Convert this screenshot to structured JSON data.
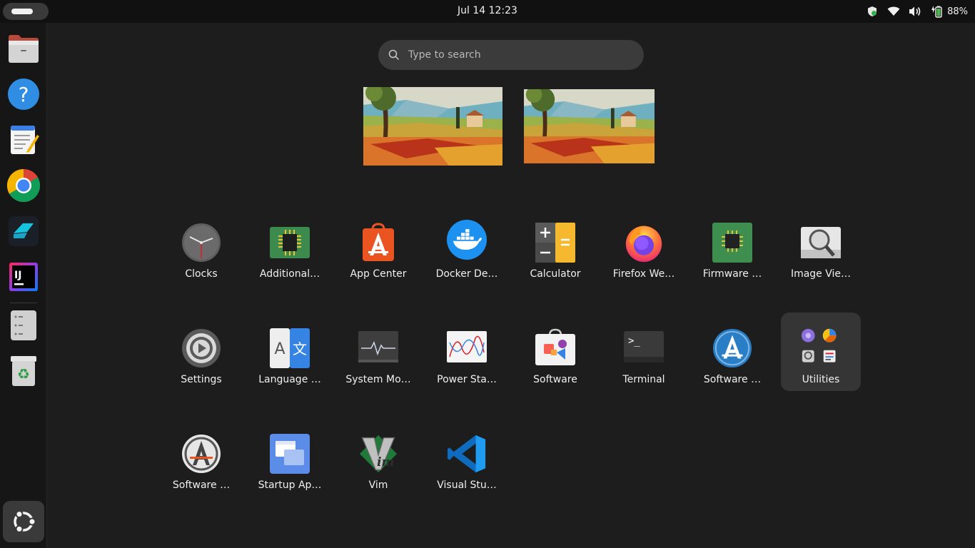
{
  "topbar": {
    "clock": "Jul 14  12:23",
    "battery_percent": "88%",
    "tray_icons": [
      "shield-icon",
      "wifi-icon",
      "volume-icon",
      "battery-icon"
    ]
  },
  "dock": {
    "items": [
      {
        "name": "files",
        "icon": "file-cabinet-icon"
      },
      {
        "name": "help",
        "icon": "help-icon"
      },
      {
        "name": "text-editor",
        "icon": "text-editor-icon"
      },
      {
        "name": "chrome",
        "icon": "chrome-icon"
      },
      {
        "name": "app-shape",
        "icon": "cyan-shape-icon"
      },
      {
        "name": "intellij",
        "icon": "intellij-icon",
        "text": "IJ"
      },
      {
        "name": "dash-app",
        "icon": "list-app-icon"
      },
      {
        "name": "trash",
        "icon": "trash-icon"
      }
    ],
    "show_apps": "ubuntu-logo-icon"
  },
  "search": {
    "placeholder": "Type to search",
    "value": ""
  },
  "apps": [
    {
      "label": "Clocks",
      "icon": "clock-icon"
    },
    {
      "label": "Additional…",
      "icon": "chip-icon"
    },
    {
      "label": "App Center",
      "icon": "app-center-icon"
    },
    {
      "label": "Docker De…",
      "icon": "docker-icon"
    },
    {
      "label": "Calculator",
      "icon": "calculator-icon"
    },
    {
      "label": "Firefox We…",
      "icon": "firefox-icon"
    },
    {
      "label": "Firmware …",
      "icon": "firmware-icon"
    },
    {
      "label": "Image Vie…",
      "icon": "image-viewer-icon"
    },
    {
      "label": "Settings",
      "icon": "gear-icon"
    },
    {
      "label": "Language …",
      "icon": "language-icon",
      "glyph_a": "A",
      "glyph_b": "文"
    },
    {
      "label": "System Mo…",
      "icon": "system-monitor-icon"
    },
    {
      "label": "Power Sta…",
      "icon": "power-stats-icon"
    },
    {
      "label": "Software",
      "icon": "software-bag-icon"
    },
    {
      "label": "Terminal",
      "icon": "terminal-icon",
      "glyph": ">_"
    },
    {
      "label": "Software …",
      "icon": "software-updater-icon"
    },
    {
      "label": "Utilities",
      "icon": "utilities-folder-icon"
    },
    {
      "label": "Software …",
      "icon": "software-properties-icon"
    },
    {
      "label": "Startup Ap…",
      "icon": "startup-apps-icon"
    },
    {
      "label": "Vim",
      "icon": "vim-icon",
      "glyph": "im"
    },
    {
      "label": "Visual Stu…",
      "icon": "vscode-icon"
    }
  ],
  "colors": {
    "background": "#1d1d1d",
    "topbar": "#111111",
    "dock": "#161616",
    "search_bg": "#3b3b3b",
    "active_tile": "#353535",
    "ubuntu_orange": "#e95420"
  }
}
